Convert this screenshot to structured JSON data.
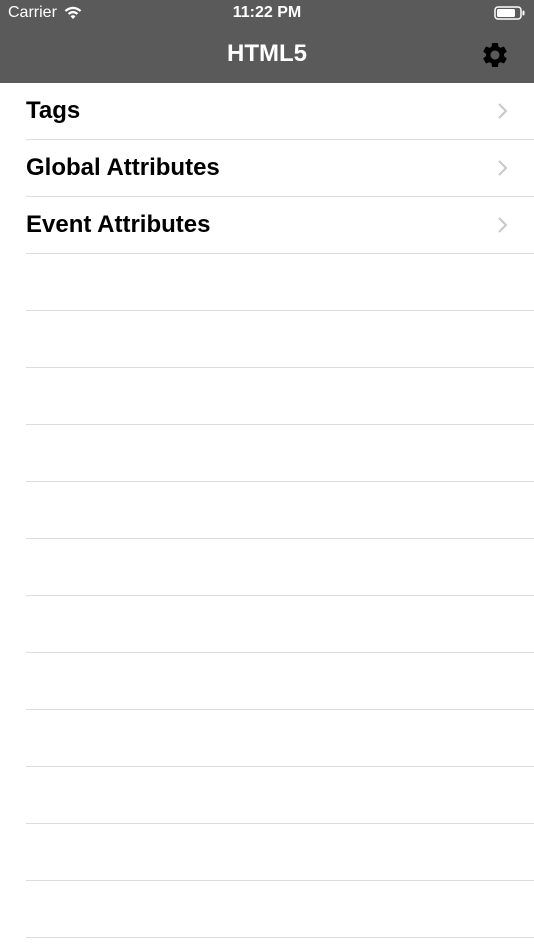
{
  "status": {
    "carrier": "Carrier",
    "time": "11:22 PM"
  },
  "nav": {
    "title": "HTML5",
    "settings_icon": "gear-icon"
  },
  "list": {
    "items": [
      {
        "label": "Tags"
      },
      {
        "label": "Global Attributes"
      },
      {
        "label": "Event Attributes"
      }
    ]
  },
  "colors": {
    "header_bg": "#5a5a5a",
    "separator": "#dcdcdc",
    "chevron": "#c7c7cc"
  }
}
